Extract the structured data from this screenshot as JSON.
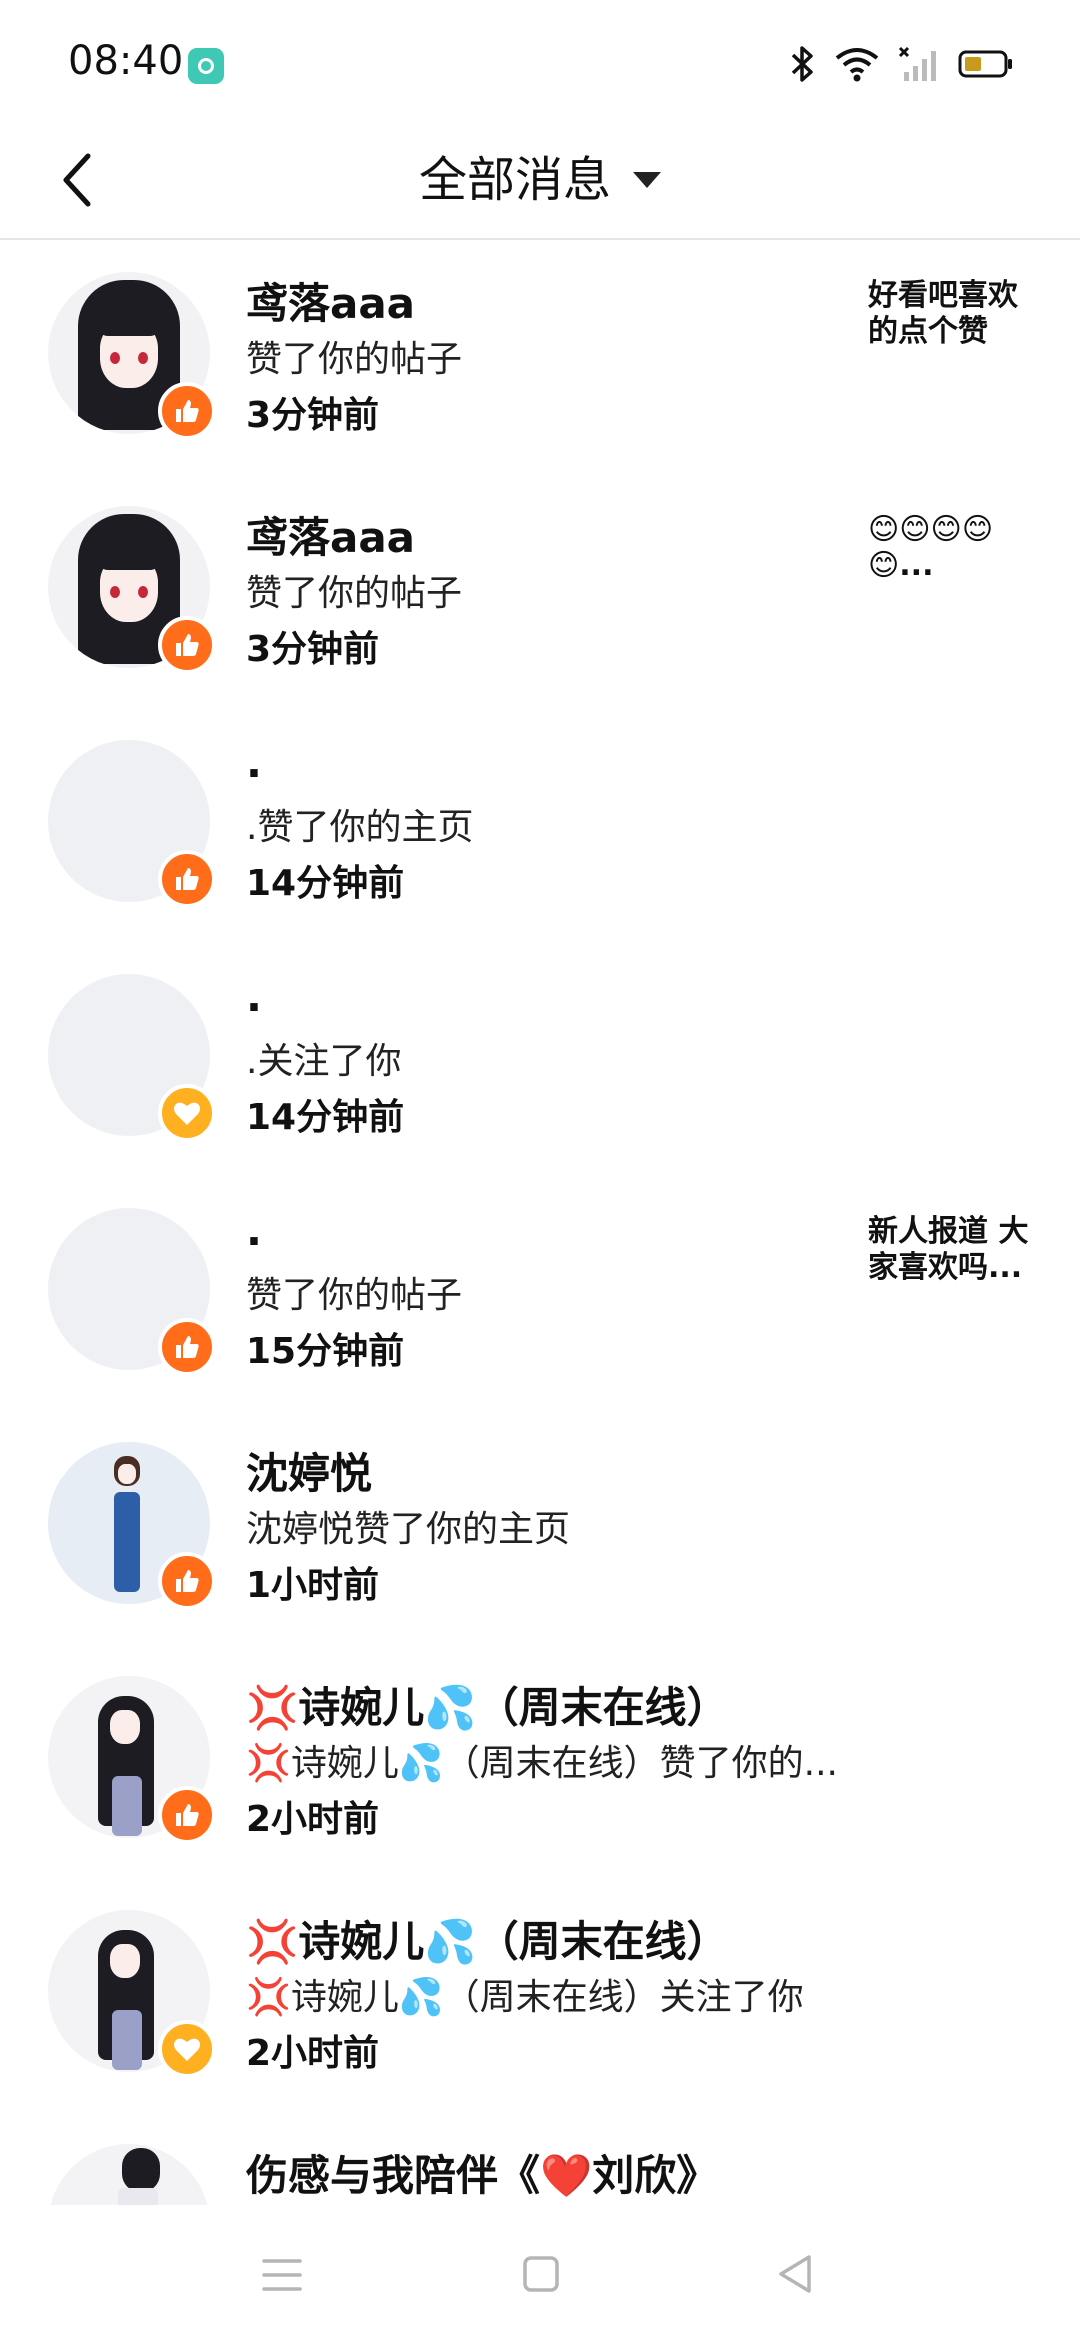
{
  "status_bar": {
    "time": "08:40",
    "icons": [
      "app-notification-icon",
      "bluetooth-icon",
      "wifi-icon",
      "signal-icon",
      "battery-icon"
    ]
  },
  "header": {
    "title": "全部消息",
    "back_icon": "chevron-left-icon",
    "dropdown_icon": "caret-down-icon"
  },
  "colors": {
    "like_badge": "#ff6d1a",
    "follow_badge": "#ffb020",
    "divider": "#e6e6e6"
  },
  "messages": [
    {
      "name": "鸢落aaa",
      "desc": "赞了你的帖子",
      "time": "3分钟前",
      "badge": "thumbs-up-icon",
      "preview": "好看吧喜欢的点个赞"
    },
    {
      "name": "鸢落aaa",
      "desc": "赞了你的帖子",
      "time": "3分钟前",
      "badge": "thumbs-up-icon",
      "preview": "😊😊😊😊😊..."
    },
    {
      "name": ".",
      "desc": ".赞了你的主页",
      "time": "14分钟前",
      "badge": "thumbs-up-icon",
      "preview": ""
    },
    {
      "name": ".",
      "desc": ".关注了你",
      "time": "14分钟前",
      "badge": "heart-icon",
      "preview": ""
    },
    {
      "name": ".",
      "desc": "赞了你的帖子",
      "time": "15分钟前",
      "badge": "thumbs-up-icon",
      "preview": "新人报道 大家喜欢吗..."
    },
    {
      "name": "沈婷悦",
      "desc": "沈婷悦赞了你的主页",
      "time": "1小时前",
      "badge": "thumbs-up-icon",
      "preview": ""
    },
    {
      "name": "💢诗婉儿💦（周末在线）",
      "desc": "💢诗婉儿💦（周末在线）赞了你的...",
      "time": "2小时前",
      "badge": "thumbs-up-icon",
      "preview": ""
    },
    {
      "name": "💢诗婉儿💦（周末在线）",
      "desc": "💢诗婉儿💦（周末在线）关注了你",
      "time": "2小时前",
      "badge": "heart-icon",
      "preview": ""
    },
    {
      "name": "伤感与我陪伴《❤️刘欣》",
      "desc": "",
      "time": "",
      "badge": "",
      "preview": ""
    }
  ],
  "nav_bar": {
    "icons": [
      "menu-icon",
      "home-square-icon",
      "back-triangle-icon"
    ]
  }
}
